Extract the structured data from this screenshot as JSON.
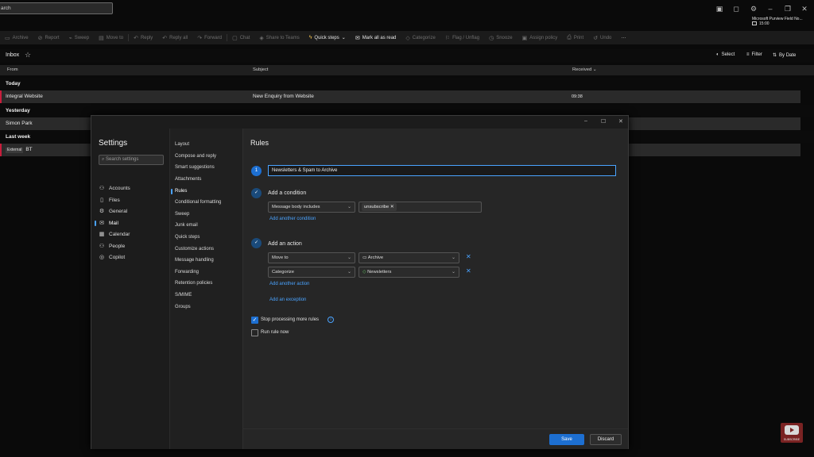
{
  "topbar": {
    "search_text": "arch",
    "account_name": "Microsoft Purview Field No...",
    "account_time": "15:00",
    "icons": [
      "meeting-icon",
      "bell-icon",
      "gear-icon",
      "minimize-icon",
      "restore-icon",
      "close-icon"
    ]
  },
  "ribbon": {
    "items": [
      {
        "label": "Archive",
        "icon": "archive-icon",
        "enabled": false
      },
      {
        "label": "Report",
        "icon": "report-icon",
        "enabled": false
      },
      {
        "label": "Sweep",
        "icon": "sweep-icon",
        "enabled": false
      },
      {
        "label": "Move to",
        "icon": "move-icon",
        "enabled": false
      },
      {
        "label": "Reply",
        "icon": "reply-icon",
        "enabled": false
      },
      {
        "label": "Reply all",
        "icon": "reply-all-icon",
        "enabled": false
      },
      {
        "label": "Forward",
        "icon": "forward-icon",
        "enabled": false
      },
      {
        "label": "Chat",
        "icon": "chat-icon",
        "enabled": false
      },
      {
        "label": "Share to Teams",
        "icon": "teams-icon",
        "enabled": false
      },
      {
        "label": "Quick steps",
        "icon": "bolt-icon",
        "enabled": true
      },
      {
        "label": "Mark all as read",
        "icon": "mail-open-icon",
        "enabled": true
      },
      {
        "label": "Categorize",
        "icon": "tag-icon",
        "enabled": false
      },
      {
        "label": "Flag / Unflag",
        "icon": "flag-icon",
        "enabled": false
      },
      {
        "label": "Snooze",
        "icon": "clock-icon",
        "enabled": false
      },
      {
        "label": "Assign policy",
        "icon": "policy-icon",
        "enabled": false
      },
      {
        "label": "Print",
        "icon": "print-icon",
        "enabled": false
      },
      {
        "label": "Undo",
        "icon": "undo-icon",
        "enabled": false
      }
    ],
    "more": "···"
  },
  "inbox": {
    "title": "Inbox",
    "select_label": "Select",
    "filter_label": "Filter",
    "sort_label": "By Date",
    "columns": {
      "from": "From",
      "subject": "Subject",
      "received": "Received"
    },
    "groups": [
      {
        "label": "Today"
      },
      {
        "label": "Yesterday"
      },
      {
        "label": "Last week"
      }
    ],
    "rows": [
      {
        "from": "Integral Website",
        "subject": "New Enquiry from Website",
        "time": "09:38"
      },
      {
        "from": "Simon Park",
        "subject": "",
        "time": ""
      },
      {
        "from": "BT",
        "tag": "External",
        "subject": "",
        "time": ""
      }
    ]
  },
  "settings": {
    "title": "Settings",
    "search_placeholder": "Search settings",
    "nav": [
      {
        "label": "Accounts",
        "icon": "person-icon"
      },
      {
        "label": "Files",
        "icon": "file-icon"
      },
      {
        "label": "General",
        "icon": "gear-icon"
      },
      {
        "label": "Mail",
        "icon": "mail-icon",
        "active": true
      },
      {
        "label": "Calendar",
        "icon": "calendar-icon"
      },
      {
        "label": "People",
        "icon": "people-icon"
      },
      {
        "label": "Copilot",
        "icon": "copilot-icon"
      }
    ],
    "subnav": [
      "Layout",
      "Compose and reply",
      "Smart suggestions",
      "Attachments",
      "Rules",
      "Conditional formatting",
      "Sweep",
      "Junk email",
      "Quick steps",
      "Customize actions",
      "Message handling",
      "Forwarding",
      "Retention policies",
      "S/MIME",
      "Groups"
    ],
    "subnav_active_index": 4
  },
  "rules": {
    "title": "Rules",
    "step_number": "1",
    "rule_name": "Newsletters & Spam to Archive",
    "condition_heading": "Add a condition",
    "condition_field": "Message body includes",
    "condition_value": "unsubscribe",
    "add_condition": "Add another condition",
    "action_heading": "Add an action",
    "actions": [
      {
        "type": "Move to",
        "value": "Archive",
        "value_icon": "folder-icon"
      },
      {
        "type": "Categorize",
        "value": "Newsletters",
        "value_icon": "tag-icon"
      }
    ],
    "add_action": "Add another action",
    "add_exception": "Add an exception",
    "stop_processing_label": "Stop processing more rules",
    "stop_processing_checked": true,
    "run_now_label": "Run rule now",
    "run_now_checked": false,
    "save_label": "Save",
    "discard_label": "Discard"
  },
  "overlay": {
    "subscribe_label": "SUBSCRIBE"
  },
  "colors": {
    "accent": "#1d6fd1",
    "link": "#4aa3ff",
    "unread_marker": "#c81e3c"
  }
}
